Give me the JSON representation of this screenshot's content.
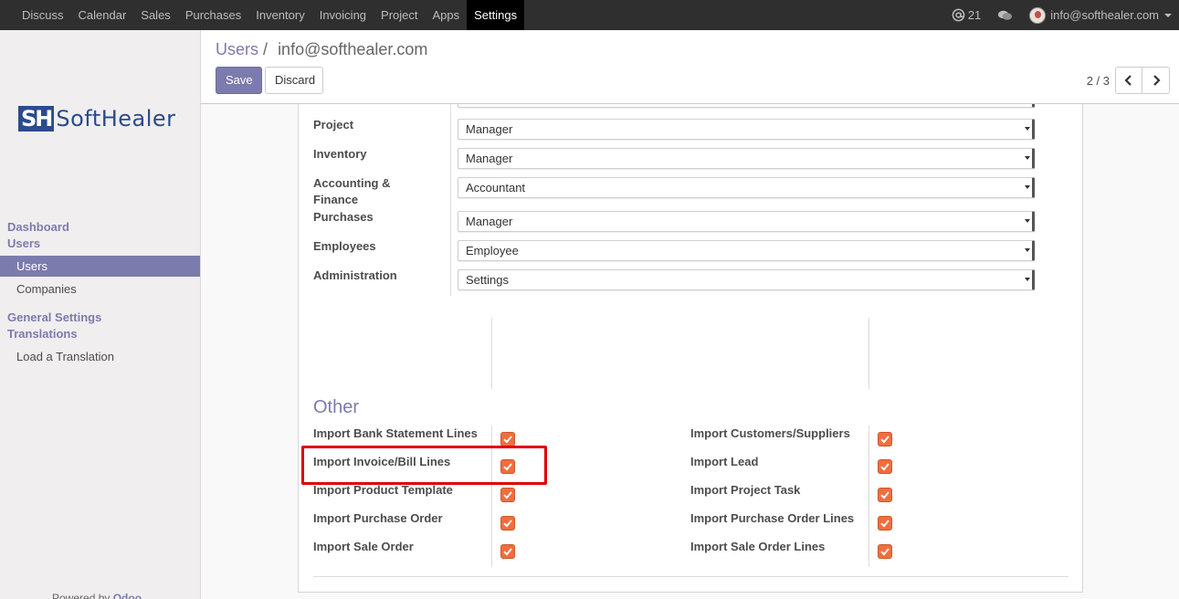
{
  "topbar": {
    "menu": [
      "Discuss",
      "Calendar",
      "Sales",
      "Purchases",
      "Inventory",
      "Invoicing",
      "Project",
      "Apps",
      "Settings"
    ],
    "active": "Settings",
    "mentions_count": "21",
    "user_email": "info@softhealer.com"
  },
  "sidebar": {
    "logo_mark": "SH",
    "logo_word": "SoftHealer",
    "heads": [
      "Dashboard",
      "Users",
      "General Settings",
      "Translations"
    ],
    "items": [
      "Users",
      "Companies",
      "Load a Translation"
    ],
    "powered_by": "Powered by",
    "powered_brand": "Odoo"
  },
  "control": {
    "breadcrumb_parent": "Users",
    "breadcrumb_sep": "/",
    "breadcrumb_current": "info@softhealer.com",
    "save_label": "Save",
    "discard_label": "Discard",
    "pager": "2 / 3"
  },
  "access_rights": [
    {
      "label": "Project",
      "value": "Manager"
    },
    {
      "label": "Inventory",
      "value": "Manager"
    },
    {
      "label": "Accounting & Finance",
      "value": "Accountant"
    },
    {
      "label": "Purchases",
      "value": "Manager"
    },
    {
      "label": "Employees",
      "value": "Employee"
    },
    {
      "label": "Administration",
      "value": "Settings"
    }
  ],
  "other": {
    "title": "Other",
    "left": [
      "Import Bank Statement Lines",
      "Import Invoice/Bill Lines",
      "Import Product Template",
      "Import Purchase Order",
      "Import Sale Order"
    ],
    "right": [
      "Import Customers/Suppliers",
      "Import Lead",
      "Import Project Task",
      "Import Purchase Order Lines",
      "Import Sale Order Lines"
    ]
  },
  "colors": {
    "accent": "#7c7bad",
    "checkbox": "#f36d3d",
    "highlight": "#e00000",
    "navbar": "#2f2f2f"
  }
}
